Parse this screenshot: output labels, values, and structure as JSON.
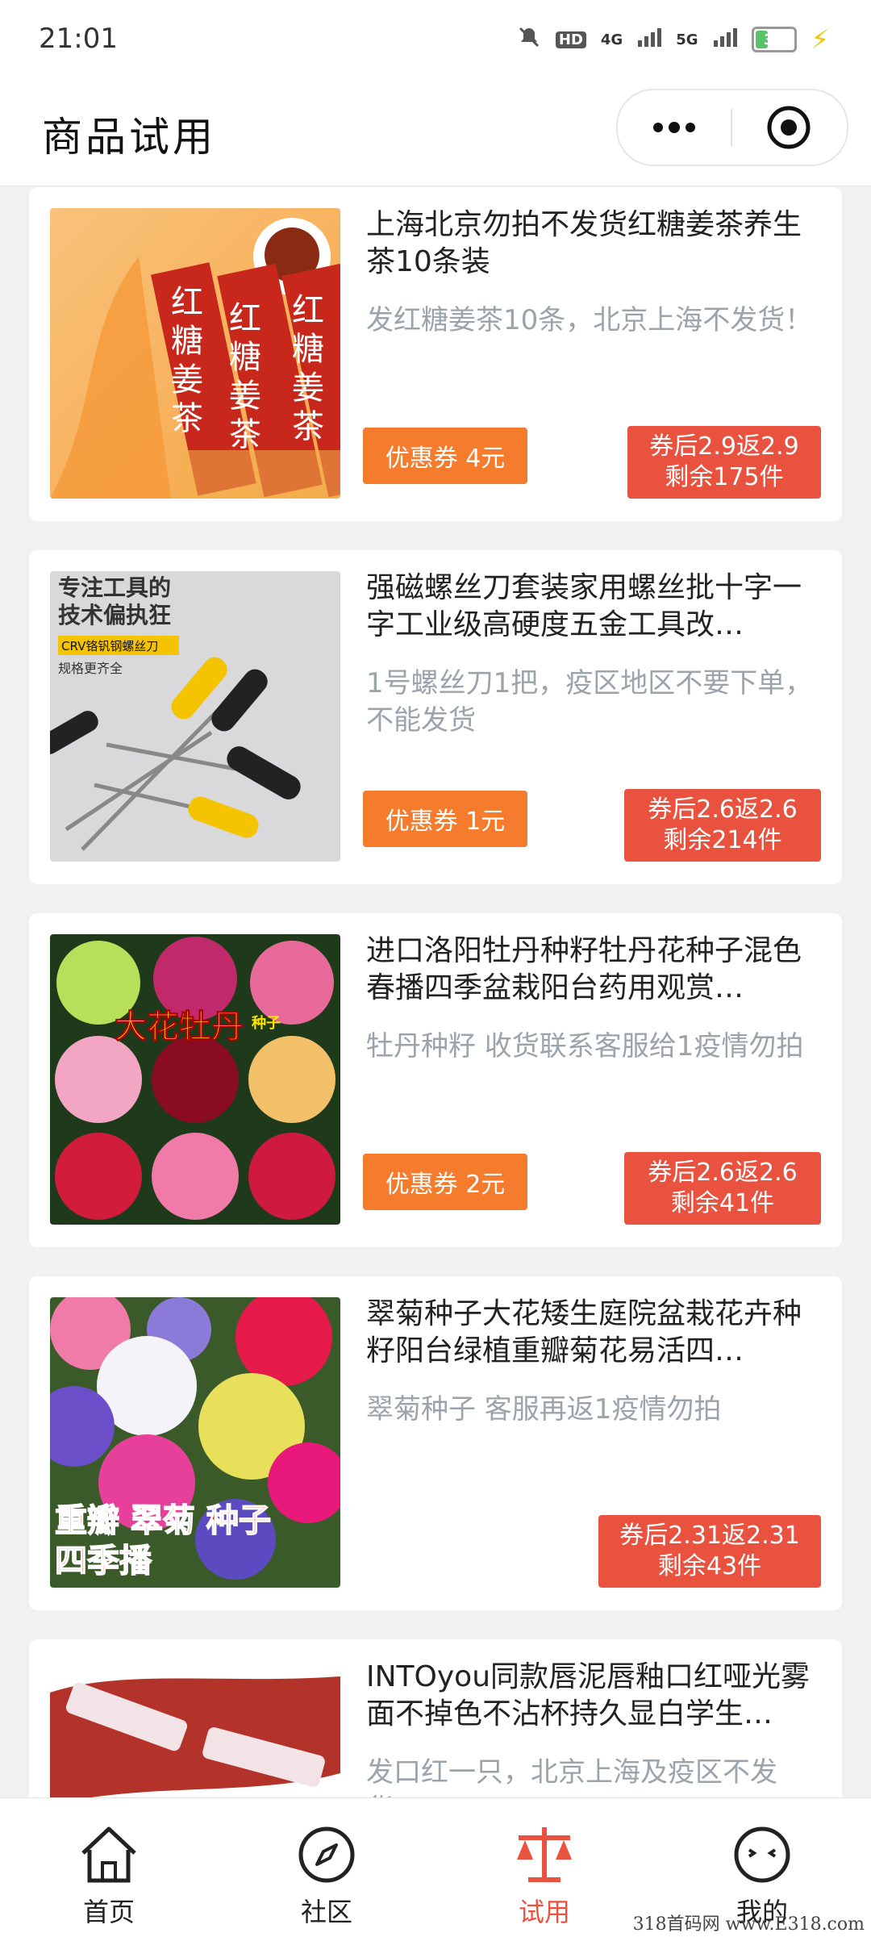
{
  "status": {
    "time": "21:01",
    "network_1": "4G",
    "network_2": "5G",
    "battery": "30",
    "hd": "HD"
  },
  "header": {
    "title": "商品试用"
  },
  "products": [
    {
      "name": "上海北京勿拍不发货红糖姜茶养生茶10条装",
      "desc": "发红糖姜茶10条，北京上海不发货！",
      "coupon": "优惠券 4元",
      "price_line": "券后2.9返2.9",
      "stock": "剩余175件"
    },
    {
      "name": "强磁螺丝刀套装家用螺丝批十字一字工业级高硬度五金工具改…",
      "desc": "1号螺丝刀1把，疫区地区不要下单，不能发货",
      "coupon": "优惠券 1元",
      "price_line": "券后2.6返2.6",
      "stock": "剩余214件"
    },
    {
      "name": "进口洛阳牡丹种籽牡丹花种子混色春播四季盆栽阳台药用观赏…",
      "desc": "牡丹种籽 收货联系客服给1疫情勿拍",
      "coupon": "优惠券 2元",
      "price_line": "券后2.6返2.6",
      "stock": "剩余41件"
    },
    {
      "name": "翠菊种子大花矮生庭院盆栽花卉种籽阳台绿植重瓣菊花易活四…",
      "desc": "翠菊种子 客服再返1疫情勿拍",
      "coupon": "",
      "price_line": "券后2.31返2.31",
      "stock": "剩余43件"
    },
    {
      "name": "INTOyou同款唇泥唇釉口红哑光雾面不掉色不沾杯持久显白学生…",
      "desc": "发口红一只，北京上海及疫区不发货！",
      "coupon": "",
      "price_line": "",
      "stock": ""
    }
  ],
  "thumb_text": {
    "tea_chars": [
      "红",
      "糖",
      "姜",
      "茶"
    ],
    "tools_line1": "专注工具的",
    "tools_line2": "技术偏执狂",
    "tools_tag": "CRV铬钒钢螺丝刀",
    "tools_sub": "规格更齐全",
    "peony_text": "大花牡丹",
    "peony_sub": "种子",
    "aster_line1": "重瓣 翠菊 种子",
    "aster_line2": "四季播"
  },
  "tabbar": [
    {
      "label": "首页",
      "icon": "home-icon",
      "active": false
    },
    {
      "label": "社区",
      "icon": "compass-icon",
      "active": false
    },
    {
      "label": "试用",
      "icon": "scale-icon",
      "active": true
    },
    {
      "label": "我的",
      "icon": "face-icon",
      "active": false
    }
  ],
  "watermark": "318首码网 www.E318.com",
  "colors": {
    "accent": "#e8523f",
    "coupon": "#f47c2c",
    "desc_gray": "#9ba3ab"
  }
}
